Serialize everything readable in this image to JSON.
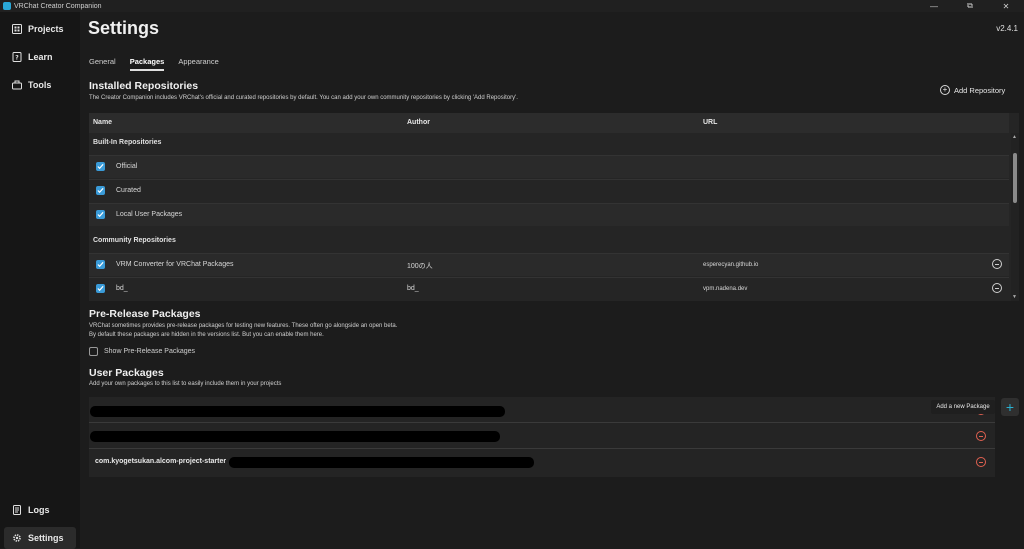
{
  "window": {
    "title": "VRChat Creator Companion",
    "minimize": "—",
    "maximize": "⧉",
    "close": "✕"
  },
  "sidebar": {
    "items": [
      {
        "label": "Projects",
        "icon": "projects-icon"
      },
      {
        "label": "Learn",
        "icon": "learn-icon"
      },
      {
        "label": "Tools",
        "icon": "tools-icon"
      }
    ],
    "bottom": [
      {
        "label": "Logs",
        "icon": "logs-icon"
      },
      {
        "label": "Settings",
        "icon": "gear-icon",
        "active": true
      }
    ]
  },
  "header": {
    "title": "Settings",
    "version": "v2.4.1"
  },
  "tabs": [
    {
      "label": "General"
    },
    {
      "label": "Packages",
      "active": true
    },
    {
      "label": "Appearance"
    }
  ],
  "installed": {
    "title": "Installed Repositories",
    "description": "The Creator Companion includes VRChat's official and curated repositories by default. You can add your own community repositories by clicking 'Add Repository'.",
    "add_button": "Add Repository",
    "columns": {
      "name": "Name",
      "author": "Author",
      "url": "URL"
    },
    "builtin_label": "Built-In Repositories",
    "builtin": [
      {
        "name": "Official",
        "checked": true
      },
      {
        "name": "Curated",
        "checked": true
      },
      {
        "name": "Local User Packages",
        "checked": true
      }
    ],
    "community_label": "Community Repositories",
    "community": [
      {
        "name": "VRM Converter for VRChat Packages",
        "author": "100の人",
        "url": "esperecyan.github.io",
        "checked": true
      },
      {
        "name": "bd_",
        "author": "bd_",
        "url": "vpm.nadena.dev",
        "checked": true
      }
    ]
  },
  "prerelease": {
    "title": "Pre-Release Packages",
    "description_1": "VRChat sometimes provides pre-release packages for testing new features. These often go alongside an open beta.",
    "description_2": "By default these packages are hidden in the versions list. But you can enable them here.",
    "checkbox_label": "Show Pre-Release Packages",
    "checked": false
  },
  "user_packages": {
    "title": "User Packages",
    "description": "Add your own packages to this list to easily include them in your projects",
    "add_tooltip": "Add a new Package",
    "add_symbol": "+",
    "items": [
      {
        "label": ""
      },
      {
        "label": ""
      },
      {
        "label": "com.kyogetsukan.alcom-project-starter"
      }
    ]
  },
  "colors": {
    "accent": "#3a9bd8",
    "remove": "#e06050",
    "background": "#1c1c1c",
    "sidebar": "#161616"
  }
}
